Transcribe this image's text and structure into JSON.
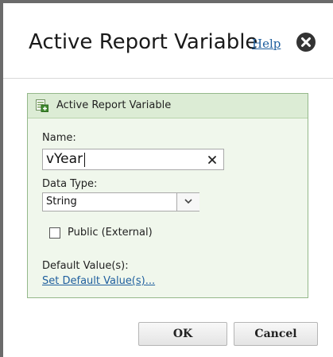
{
  "dialog": {
    "title": "Active Report Variable",
    "help_label": "Help",
    "close_icon": "close-circle-icon"
  },
  "panel": {
    "title": "Active Report Variable",
    "icon": "report-variable-icon",
    "name_label": "Name:",
    "name_value": "vYear",
    "clear_icon": "clear-x-icon",
    "data_type_label": "Data Type:",
    "data_type_value": "String",
    "dropdown_icon": "chevron-down-icon",
    "public_label": "Public (External)",
    "public_checked": false,
    "default_values_label": "Default Value(s):",
    "set_default_link": "Set Default Value(s)..."
  },
  "buttons": {
    "ok_label": "OK",
    "cancel_label": "Cancel"
  },
  "colors": {
    "panel_border": "#94b88a",
    "panel_background": "#f0f7ec",
    "panel_header": "#dcecd5",
    "link": "#1f5f9e"
  }
}
